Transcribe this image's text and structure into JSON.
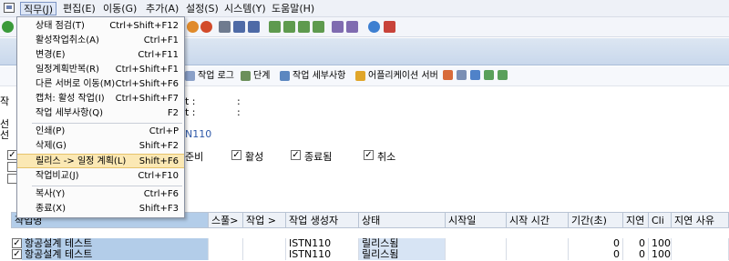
{
  "menubar": {
    "items": [
      "직무(J)",
      "편집(E)",
      "이동(G)",
      "추가(A)",
      "설정(S)",
      "시스템(Y)",
      "도움말(H)"
    ]
  },
  "job_menu": {
    "items": [
      {
        "label": "상태 점검(T)",
        "shortcut": "Ctrl+Shift+F12"
      },
      {
        "label": "활성작업취소(A)",
        "shortcut": "Ctrl+F1"
      },
      {
        "label": "변경(E)",
        "shortcut": "Ctrl+F11"
      },
      {
        "label": "일정계획반복(R)",
        "shortcut": "Ctrl+Shift+F1"
      },
      {
        "label": "다른 서버로 이동(M)",
        "shortcut": "Ctrl+Shift+F6"
      },
      {
        "label": "캡처: 활성 작업(I)",
        "shortcut": "Ctrl+Shift+F7"
      },
      {
        "label": "작업 세부사항(Q)",
        "shortcut": "F2"
      },
      {
        "label": "인쇄(P)",
        "shortcut": "Ctrl+P"
      },
      {
        "label": "삭제(G)",
        "shortcut": "Shift+F2"
      },
      {
        "label": "릴리스 -> 일정 계획(L)",
        "shortcut": "Shift+F6"
      },
      {
        "label": "작업비교(J)",
        "shortcut": "Ctrl+F10"
      },
      {
        "label": "복사(Y)",
        "shortcut": "Ctrl+F6"
      },
      {
        "label": "종료(X)",
        "shortcut": "Shift+F3"
      }
    ]
  },
  "app_toolbar": {
    "job_log": "작업 로그",
    "steps": "단계",
    "job_details": "작업 세부사항",
    "app_server": "어플리케이션 서버"
  },
  "fields": {
    "left_1": "작",
    "left_2": "선",
    "left_3": "선",
    "t1": "t :",
    "t2": "t :",
    "c1": ":",
    "c2": ":",
    "user_fragment": "N110"
  },
  "status_filters": {
    "ready": "준비",
    "active": "활성",
    "finished": "종료됨",
    "canceled": "취소"
  },
  "table": {
    "columns": [
      "작업명",
      "스풀>",
      "작업 >",
      "작업 생성자",
      "상태",
      "시작일",
      "시작 시간",
      "기간(초)",
      "지연",
      "Cli",
      "지연 사유"
    ],
    "rows": [
      {
        "name": "항공설계 테스트",
        "creator": "ISTN110",
        "status": "릴리스됨",
        "duration": "0",
        "delay": "0",
        "client": "100"
      },
      {
        "name": "항공설계 테스트",
        "creator": "ISTN110",
        "status": "릴리스됨",
        "duration": "0",
        "delay": "0",
        "client": "100"
      }
    ]
  },
  "colors": {
    "accent": "#b3cde9",
    "highlight": "#fbe8b4",
    "menu_active": "#dde6f6"
  }
}
